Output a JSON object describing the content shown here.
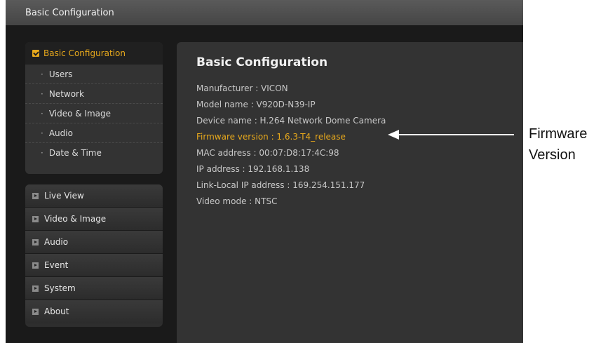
{
  "app": {
    "title": "Basic Configuration"
  },
  "sidebar": {
    "section_label": "Basic Configuration",
    "sub_items": [
      {
        "label": "Users"
      },
      {
        "label": "Network"
      },
      {
        "label": "Video & Image"
      },
      {
        "label": "Audio"
      },
      {
        "label": "Date & Time"
      }
    ],
    "nav_items": [
      {
        "label": "Live View"
      },
      {
        "label": "Video & Image"
      },
      {
        "label": "Audio"
      },
      {
        "label": "Event"
      },
      {
        "label": "System"
      },
      {
        "label": "About"
      }
    ]
  },
  "main": {
    "title": "Basic Configuration",
    "info": [
      {
        "text": "Manufacturer : VICON"
      },
      {
        "text": "Model name : V920D-N39-IP"
      },
      {
        "text": "Device name : H.264 Network Dome Camera"
      },
      {
        "text": "Firmware version : 1.6.3-T4_release"
      },
      {
        "text": "MAC address : 00:07:D8:17:4C:98"
      },
      {
        "text": "IP address : 192.168.1.138"
      },
      {
        "text": "Link-Local IP address : 169.254.151.177"
      },
      {
        "text": "Video mode : NTSC"
      }
    ]
  },
  "annotation": {
    "line1": "Firmware",
    "line2": "Version"
  },
  "colors": {
    "accent": "#e8a91c",
    "panel": "#333333",
    "background": "#1a1a1a"
  }
}
